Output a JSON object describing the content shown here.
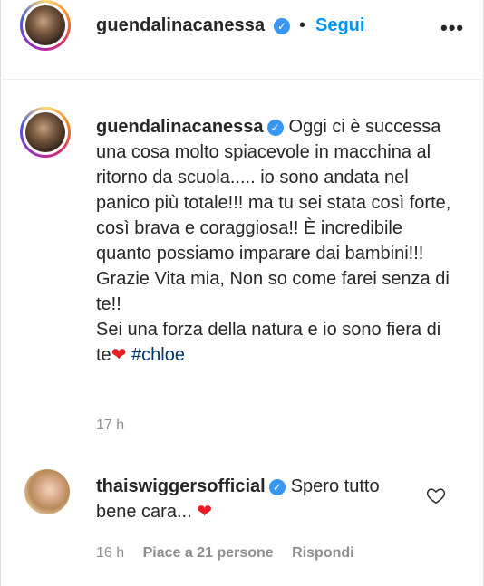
{
  "header": {
    "username": "guendalinacanessa",
    "separator": "•",
    "follow_label": "Segui",
    "more_label": "•••"
  },
  "caption": {
    "username": "guendalinacanessa",
    "text_before_heart": "Oggi ci è successa una cosa molto spiacevole in macchina al ritorno da scuola..... io sono andata nel panico più totale!!! ma tu sei stata così forte, così brava e coraggiosa!! È incredibile quanto possiamo imparare dai bambini!!! Grazie Vita mia, Non so come farei senza di te!!",
    "text_line2": "Sei una forza della natura e io sono fiera di te",
    "heart": "❤",
    "hashtag": "#chloe",
    "time": "17 h"
  },
  "comment": {
    "username": "thaiswiggersofficial",
    "text": "Spero tutto bene cara...",
    "heart": "❤",
    "time": "16 h",
    "likes": "Piace a 21 persone",
    "reply_label": "Rispondi"
  },
  "icons": {
    "verified": "✓"
  },
  "colors": {
    "accent": "#0095f6",
    "verified": "#3897f0",
    "hashtag": "#00376b",
    "muted": "#8e8e8e",
    "heart": "#ed1c24"
  }
}
